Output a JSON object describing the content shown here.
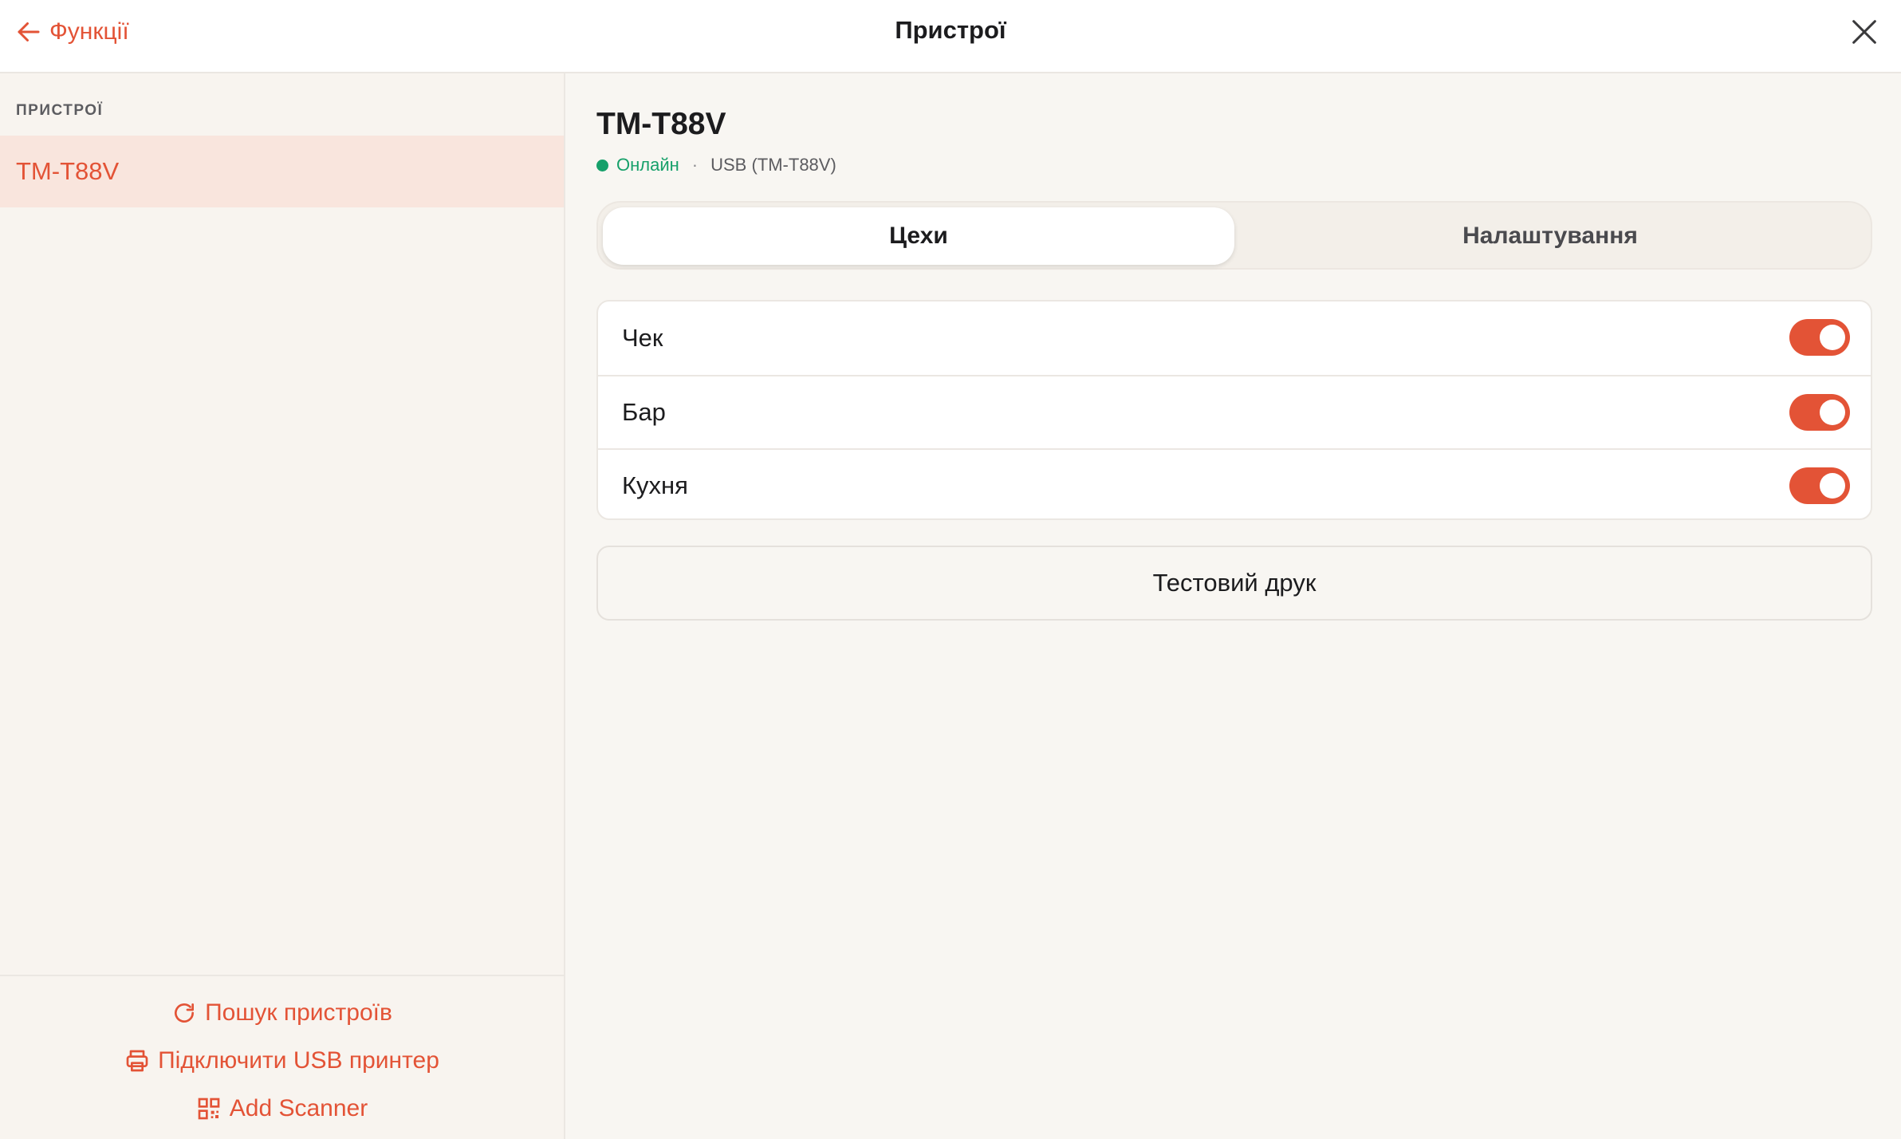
{
  "header": {
    "back_label": "Функції",
    "title": "Пристрої",
    "back_icon": "arrow-left-icon",
    "close_icon": "close-icon"
  },
  "sidebar": {
    "section_label": "ПРИСТРОЇ",
    "items": [
      {
        "label": "TM-T88V",
        "selected": true
      }
    ],
    "actions": [
      {
        "label": "Пошук пристроїв",
        "icon": "refresh-icon"
      },
      {
        "label": "Підключити USB принтер",
        "icon": "printer-icon"
      },
      {
        "label": "Add Scanner",
        "icon": "qr-code-icon"
      }
    ]
  },
  "device": {
    "name": "TM-T88V",
    "status": "Онлайн",
    "separator": "·",
    "connection": "USB (TM-T88V)"
  },
  "tabs": [
    {
      "label": "Цехи",
      "active": true
    },
    {
      "label": "Налаштування",
      "active": false
    }
  ],
  "workshops": [
    {
      "label": "Чек",
      "enabled": true
    },
    {
      "label": "Бар",
      "enabled": true
    },
    {
      "label": "Кухня",
      "enabled": true
    }
  ],
  "test_print_label": "Тестовий друк",
  "colors": {
    "accent": "#e35336",
    "online": "#16a06a",
    "selected_bg": "#f9e5dd",
    "background": "#f8f6f2"
  }
}
